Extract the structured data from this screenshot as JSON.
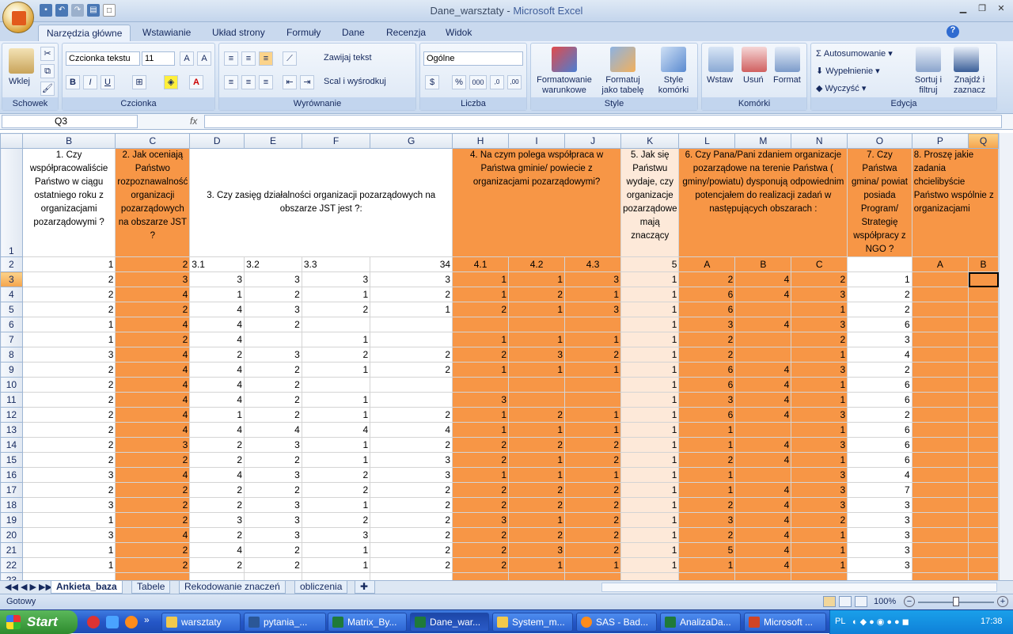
{
  "window": {
    "doc_name": "Dane_warsztaty",
    "separator": " - ",
    "app_name": "Microsoft Excel"
  },
  "ribbon_tabs": [
    "Narzędzia główne",
    "Wstawianie",
    "Układ strony",
    "Formuły",
    "Dane",
    "Recenzja",
    "Widok"
  ],
  "ribbon": {
    "clipboard": {
      "paste": "Wklej",
      "label": "Schowek"
    },
    "font": {
      "name": "Czcionka tekstu",
      "size": "11",
      "bold": "B",
      "italic": "I",
      "underline": "U",
      "label": "Czcionka"
    },
    "alignment": {
      "wrap": "Zawijaj tekst",
      "merge": "Scal i wyśrodkuj",
      "label": "Wyrównanie"
    },
    "number": {
      "format": "Ogólne",
      "percent": "%",
      "thousands": "000",
      "inc_dec": ",00\n,0",
      "label": "Liczba"
    },
    "styles": {
      "cond": "Formatowanie warunkowe",
      "table": "Formatuj jako tabelę",
      "cell": "Style komórki",
      "label": "Style"
    },
    "cells": {
      "insert": "Wstaw",
      "delete": "Usuń",
      "format": "Format",
      "label": "Komórki"
    },
    "editing": {
      "autosum": "Autosumowanie",
      "fill": "Wypełnienie",
      "clear": "Wyczyść",
      "sort": "Sortuj i filtruj",
      "find": "Znajdź i zaznacz",
      "label": "Edycja"
    }
  },
  "formula_bar": {
    "name_box": "Q3",
    "fx": "fx",
    "formula": ""
  },
  "columns": [
    "B",
    "C",
    "D",
    "E",
    "F",
    "G",
    "H",
    "I",
    "J",
    "K",
    "L",
    "M",
    "N",
    "O",
    "P",
    "Q"
  ],
  "header_row": {
    "b": "1. Czy współpracowaliście Państwo w ciągu ostatniego roku z organizacjami pozarządowymi ?",
    "c": "2. Jak oceniają Państwo rozpoznawalność organizacji pozarządowych na obszarze JST ?",
    "d_g": "3. Czy zasięg działalności organizacji pozarządowych na obszarze JST jest ?:",
    "h_j": "4. Na czym polega współpraca w Państwa gminie/ powiecie z organizacjami pozarządowymi?",
    "k": "5. Jak się Państwu wydaje, czy organizacje pozarządowe mają znaczący",
    "l_n": "6. Czy Pana/Pani zdaniem organizacje pozarządowe na terenie Państwa ( gminy/powiatu) dysponują odpowiednim potencjałem do realizacji zadań w następujących obszarach :",
    "o": "7. Czy Państwa gmina/ powiat posiada Program/ Strategię współpracy z NGO ?",
    "p_q": "8. Proszę jakie zadania chcielibyście Państwo wspólnie z organizacjami"
  },
  "code_row": [
    "1",
    "2",
    "3.1",
    "3.2",
    "3.3",
    "34",
    "4.1",
    "4.2",
    "4.3",
    "5",
    "A",
    "B",
    "C",
    "",
    "A",
    "B"
  ],
  "rows": [
    {
      "n": "3",
      "v": [
        "2",
        "3",
        "3",
        "3",
        "3",
        "3",
        "1",
        "1",
        "3",
        "1",
        "2",
        "4",
        "2",
        "1",
        "",
        ""
      ]
    },
    {
      "n": "4",
      "v": [
        "2",
        "4",
        "1",
        "2",
        "1",
        "2",
        "1",
        "2",
        "1",
        "1",
        "6",
        "4",
        "3",
        "2",
        "",
        ""
      ]
    },
    {
      "n": "5",
      "v": [
        "2",
        "2",
        "4",
        "3",
        "2",
        "1",
        "2",
        "1",
        "3",
        "1",
        "6",
        "",
        "1",
        "2",
        "",
        ""
      ]
    },
    {
      "n": "6",
      "v": [
        "1",
        "4",
        "4",
        "2",
        "",
        "",
        "",
        "",
        "",
        "1",
        "3",
        "4",
        "3",
        "6",
        "",
        ""
      ]
    },
    {
      "n": "7",
      "v": [
        "1",
        "2",
        "4",
        "",
        "1",
        "",
        "1",
        "1",
        "1",
        "1",
        "2",
        "",
        "2",
        "3",
        "",
        ""
      ]
    },
    {
      "n": "8",
      "v": [
        "3",
        "4",
        "2",
        "3",
        "2",
        "2",
        "2",
        "3",
        "2",
        "1",
        "2",
        "",
        "1",
        "4",
        "",
        ""
      ]
    },
    {
      "n": "9",
      "v": [
        "2",
        "4",
        "4",
        "2",
        "1",
        "2",
        "1",
        "1",
        "1",
        "1",
        "6",
        "4",
        "3",
        "2",
        "",
        ""
      ]
    },
    {
      "n": "10",
      "v": [
        "2",
        "4",
        "4",
        "2",
        "",
        "",
        "",
        "",
        "",
        "1",
        "6",
        "4",
        "1",
        "6",
        "",
        ""
      ]
    },
    {
      "n": "11",
      "v": [
        "2",
        "4",
        "4",
        "2",
        "1",
        "",
        "3",
        "",
        "",
        "1",
        "3",
        "4",
        "1",
        "6",
        "",
        ""
      ]
    },
    {
      "n": "12",
      "v": [
        "2",
        "4",
        "1",
        "2",
        "1",
        "2",
        "1",
        "2",
        "1",
        "1",
        "6",
        "4",
        "3",
        "2",
        "",
        ""
      ]
    },
    {
      "n": "13",
      "v": [
        "2",
        "4",
        "4",
        "4",
        "4",
        "4",
        "1",
        "1",
        "1",
        "1",
        "1",
        "",
        "1",
        "6",
        "",
        ""
      ]
    },
    {
      "n": "14",
      "v": [
        "2",
        "3",
        "2",
        "3",
        "1",
        "2",
        "2",
        "2",
        "2",
        "1",
        "1",
        "4",
        "3",
        "6",
        "",
        ""
      ]
    },
    {
      "n": "15",
      "v": [
        "2",
        "2",
        "2",
        "2",
        "1",
        "3",
        "2",
        "1",
        "2",
        "1",
        "2",
        "4",
        "1",
        "6",
        "",
        ""
      ]
    },
    {
      "n": "16",
      "v": [
        "3",
        "4",
        "4",
        "3",
        "2",
        "3",
        "1",
        "1",
        "1",
        "1",
        "1",
        "",
        "3",
        "4",
        "",
        ""
      ]
    },
    {
      "n": "17",
      "v": [
        "2",
        "2",
        "2",
        "2",
        "2",
        "2",
        "2",
        "2",
        "2",
        "1",
        "1",
        "4",
        "3",
        "7",
        "",
        ""
      ]
    },
    {
      "n": "18",
      "v": [
        "3",
        "2",
        "2",
        "3",
        "1",
        "2",
        "2",
        "2",
        "2",
        "1",
        "2",
        "4",
        "3",
        "3",
        "",
        ""
      ]
    },
    {
      "n": "19",
      "v": [
        "1",
        "2",
        "3",
        "3",
        "2",
        "2",
        "3",
        "1",
        "2",
        "1",
        "3",
        "4",
        "2",
        "3",
        "",
        ""
      ]
    },
    {
      "n": "20",
      "v": [
        "3",
        "4",
        "2",
        "3",
        "3",
        "2",
        "2",
        "2",
        "2",
        "1",
        "2",
        "4",
        "1",
        "3",
        "",
        ""
      ]
    },
    {
      "n": "21",
      "v": [
        "1",
        "2",
        "4",
        "2",
        "1",
        "2",
        "2",
        "3",
        "2",
        "1",
        "5",
        "4",
        "1",
        "3",
        "",
        ""
      ]
    },
    {
      "n": "22",
      "v": [
        "1",
        "2",
        "2",
        "2",
        "1",
        "2",
        "2",
        "1",
        "1",
        "1",
        "1",
        "4",
        "1",
        "3",
        "",
        ""
      ]
    },
    {
      "n": "23",
      "v": [
        "",
        "",
        "",
        "",
        "",
        "",
        "",
        "",
        "",
        "",
        "",
        "",
        "",
        "",
        "",
        ""
      ]
    }
  ],
  "sheets": [
    "Ankieta_baza",
    "Tabele",
    "Rekodowanie znaczeń",
    "obliczenia"
  ],
  "status": {
    "ready": "Gotowy",
    "zoom": "100%"
  },
  "taskbar": {
    "start": "Start",
    "items": [
      "warsztaty",
      "pytania_...",
      "Matrix_By...",
      "Dane_war...",
      "System_m...",
      "SAS - Bad...",
      "AnalizaDa...",
      "Microsoft ..."
    ],
    "lang": "PL",
    "clock": "17:38"
  },
  "colors": {
    "orange": "#f79646",
    "peach": "#fde9d9",
    "header_blue": "#dfe7f1"
  }
}
